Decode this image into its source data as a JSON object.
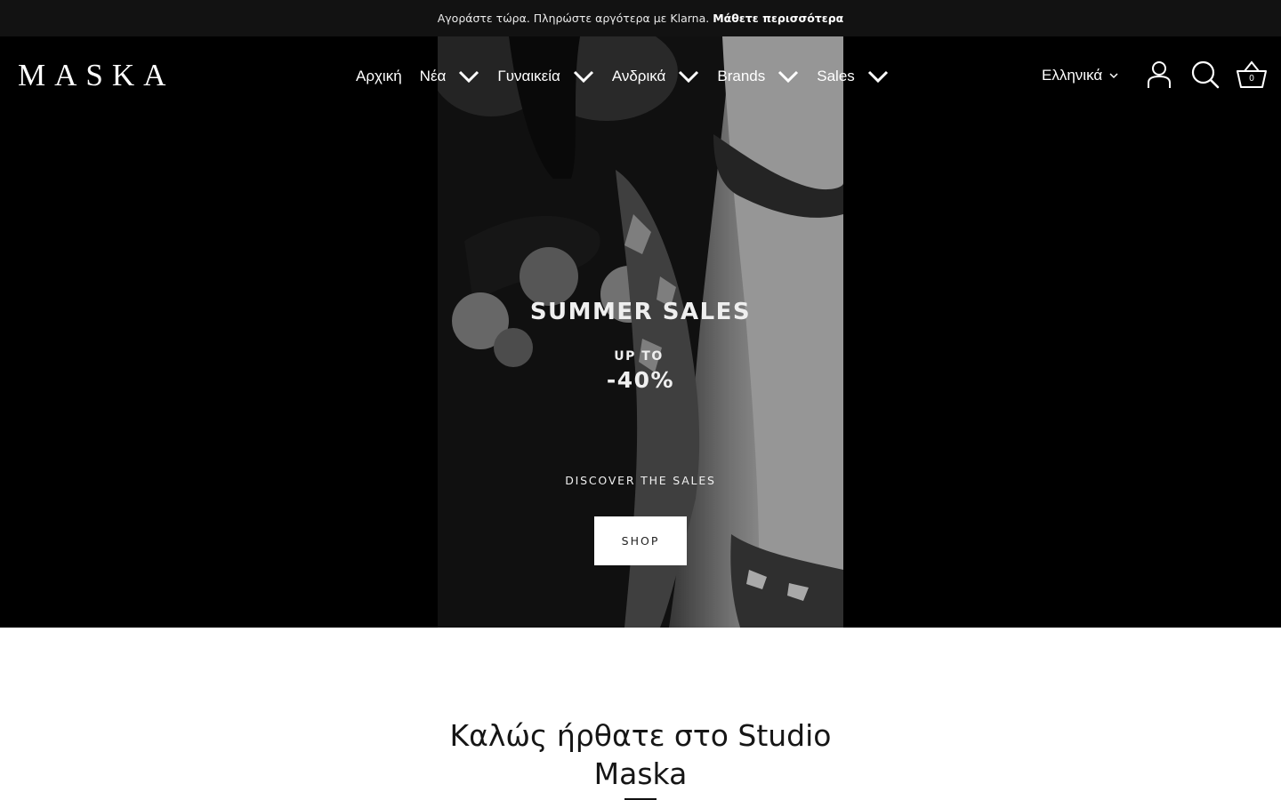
{
  "announcement": {
    "text": "Αγοράστε τώρα. Πληρώστε αργότερα με Klarna.",
    "link": "Μάθετε περισσότερα"
  },
  "header": {
    "logo": "MASKA",
    "nav": [
      {
        "label": "Αρχική",
        "has_dropdown": false
      },
      {
        "label": "Νέα",
        "has_dropdown": true
      },
      {
        "label": "Γυναικεία",
        "has_dropdown": true
      },
      {
        "label": "Ανδρικά",
        "has_dropdown": true
      },
      {
        "label": "Brands",
        "has_dropdown": true
      },
      {
        "label": "Sales",
        "has_dropdown": true
      }
    ],
    "language": "Ελληνικά",
    "icons": [
      "account-icon",
      "search-icon",
      "basket-icon"
    ],
    "cart_count": "0"
  },
  "hero": {
    "title": "SUMMER SALES",
    "upto": "UP TO",
    "percent": "-40%",
    "discover": "DISCOVER THE SALES",
    "button": "SHOP"
  },
  "welcome": {
    "line1": "Καλώς ήρθατε στο Studio",
    "line2": "Maska"
  },
  "colors": {
    "announcement_bg": "#121212",
    "hero_bg": "#000000",
    "button_bg": "#ffffff"
  }
}
